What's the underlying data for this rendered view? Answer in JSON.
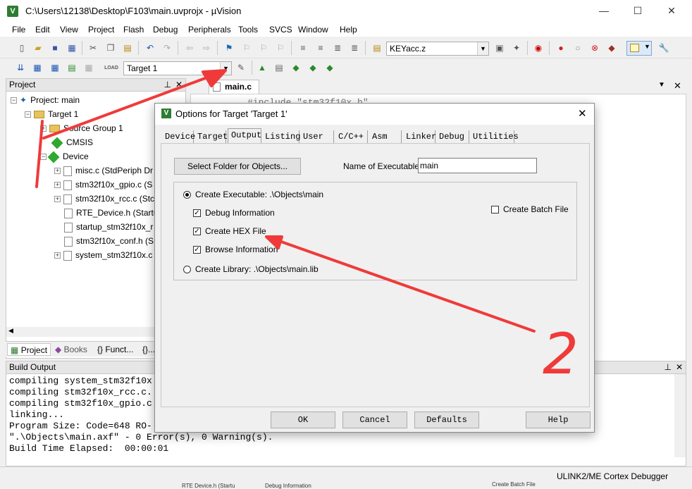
{
  "window": {
    "title": "C:\\Users\\12138\\Desktop\\F103\\main.uvprojx - µVision"
  },
  "menu": [
    "File",
    "Edit",
    "View",
    "Project",
    "Flash",
    "Debug",
    "Peripherals",
    "Tools",
    "SVCS",
    "Window",
    "Help"
  ],
  "toolbar": {
    "find_combo": "KEYacc.z",
    "target_combo": "Target 1"
  },
  "project_panel": {
    "header": "Project",
    "tree": [
      {
        "label": "Project: main"
      },
      {
        "label": "Target 1"
      },
      {
        "label": "Source Group 1"
      },
      {
        "label": "CMSIS"
      },
      {
        "label": "Device"
      },
      {
        "label": "misc.c (StdPeriph Dr"
      },
      {
        "label": "stm32f10x_gpio.c (S"
      },
      {
        "label": "stm32f10x_rcc.c (Stc"
      },
      {
        "label": "RTE_Device.h (Startu"
      },
      {
        "label": "startup_stm32f10x_r"
      },
      {
        "label": "stm32f10x_conf.h (S"
      },
      {
        "label": "system_stm32f10x.c"
      }
    ],
    "tabs": [
      "Project",
      "Books",
      "{} Funct...",
      "{}..."
    ]
  },
  "editor": {
    "tab": "main.c",
    "code_line": "#include \"stm32f10x.h\""
  },
  "build_output": {
    "header": "Build Output",
    "lines": [
      "compiling system_stm32f10x",
      "compiling stm32f10x_rcc.c.",
      "compiling stm32f10x_gpio.c",
      "linking...",
      "Program Size: Code=648 RO-",
      "\".\\Objects\\main.axf\" - 0 Error(s), 0 Warning(s).",
      "Build Time Elapsed:  00:00:01"
    ]
  },
  "status": {
    "debugger": "ULINK2/ME Cortex Debugger"
  },
  "bottom_fragment": {
    "left": "RTE Device.h (Startu",
    "mid": "Debug Information",
    "right": "Create Batch File"
  },
  "dialog": {
    "title": "Options for Target 'Target 1'",
    "tabs": [
      "Device",
      "Target",
      "Output",
      "Listing",
      "User",
      "C/C++",
      "Asm",
      "Linker",
      "Debug",
      "Utilities"
    ],
    "active_tab": "Output",
    "select_folder_button": "Select Folder for Objects...",
    "name_exec_label": "Name of Executable:",
    "name_exec_value": "main",
    "create_exec": "Create Executable:  .\\Objects\\main",
    "debug_info": "Debug Information",
    "create_hex": "Create HEX File",
    "browse_info": "Browse Information",
    "create_lib": "Create Library:  .\\Objects\\main.lib",
    "create_batch": "Create Batch File",
    "buttons": {
      "ok": "OK",
      "cancel": "Cancel",
      "defaults": "Defaults",
      "help": "Help"
    }
  },
  "annotation": {
    "stroke_color": "#f03a3a",
    "number": "2"
  }
}
